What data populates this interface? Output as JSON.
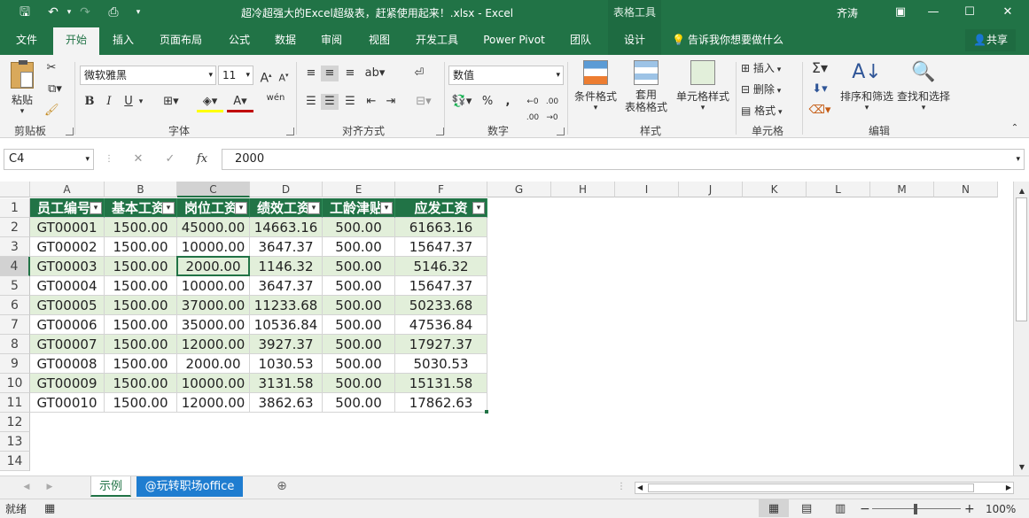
{
  "title_bar": {
    "doc_title": "超冷超强大的Excel超级表，赶紧使用起来！.xlsx  -  Excel",
    "context_tab": "表格工具",
    "user_name": "齐涛",
    "minimize": "—",
    "restore": "❐",
    "maximize": "☐",
    "close": "✕"
  },
  "tabs": [
    "文件",
    "开始",
    "插入",
    "页面布局",
    "公式",
    "数据",
    "审阅",
    "视图",
    "开发工具",
    "Power Pivot",
    "团队",
    "设计"
  ],
  "tell_me": "告诉我你想要做什么",
  "share": "共享",
  "ribbon": {
    "clipboard": {
      "paste": "粘贴",
      "label": "剪贴板"
    },
    "font": {
      "name": "微软雅黑",
      "size": "11",
      "bold": "B",
      "italic": "I",
      "underline": "U",
      "label": "字体"
    },
    "alignment": {
      "label": "对齐方式"
    },
    "number": {
      "format": "数值",
      "percent": "%",
      "comma": ",",
      "label": "数字"
    },
    "styles": {
      "conditional": "条件格式",
      "table_line1": "套用",
      "table_line2": "表格格式",
      "cell_styles": "单元格样式",
      "label": "样式"
    },
    "cells": {
      "insert": "插入",
      "delete": "删除",
      "format": "格式",
      "label": "单元格"
    },
    "editing": {
      "sort": "排序和筛选",
      "find": "查找和选择",
      "label": "编辑"
    }
  },
  "formula_bar": {
    "name_box": "C4",
    "fx": "fx",
    "value": "2000"
  },
  "columns": [
    "A",
    "B",
    "C",
    "D",
    "E",
    "F",
    "G",
    "H",
    "I",
    "J",
    "K",
    "L",
    "M",
    "N"
  ],
  "rows": [
    "1",
    "2",
    "3",
    "4",
    "5",
    "6",
    "7",
    "8",
    "9",
    "10",
    "11",
    "12",
    "13",
    "14"
  ],
  "table": {
    "headers": [
      "员工编号",
      "基本工资",
      "岗位工资",
      "绩效工资",
      "工龄津贴",
      "应发工资"
    ],
    "data": [
      [
        "GT00001",
        "1500.00",
        "45000.00",
        "14663.16",
        "500.00",
        "61663.16"
      ],
      [
        "GT00002",
        "1500.00",
        "10000.00",
        "3647.37",
        "500.00",
        "15647.37"
      ],
      [
        "GT00003",
        "1500.00",
        "2000.00",
        "1146.32",
        "500.00",
        "5146.32"
      ],
      [
        "GT00004",
        "1500.00",
        "10000.00",
        "3647.37",
        "500.00",
        "15647.37"
      ],
      [
        "GT00005",
        "1500.00",
        "37000.00",
        "11233.68",
        "500.00",
        "50233.68"
      ],
      [
        "GT00006",
        "1500.00",
        "35000.00",
        "10536.84",
        "500.00",
        "47536.84"
      ],
      [
        "GT00007",
        "1500.00",
        "12000.00",
        "3927.37",
        "500.00",
        "17927.37"
      ],
      [
        "GT00008",
        "1500.00",
        "2000.00",
        "1030.53",
        "500.00",
        "5030.53"
      ],
      [
        "GT00009",
        "1500.00",
        "10000.00",
        "3131.58",
        "500.00",
        "15131.58"
      ],
      [
        "GT00010",
        "1500.00",
        "12000.00",
        "3862.63",
        "500.00",
        "17862.63"
      ]
    ]
  },
  "sheets": [
    "示例",
    "@玩转职场office"
  ],
  "status": {
    "ready": "就绪",
    "zoom": "100%"
  },
  "colors": {
    "accent": "#217346",
    "band": "#e2efda",
    "sheet2": "#1f7dd0"
  }
}
